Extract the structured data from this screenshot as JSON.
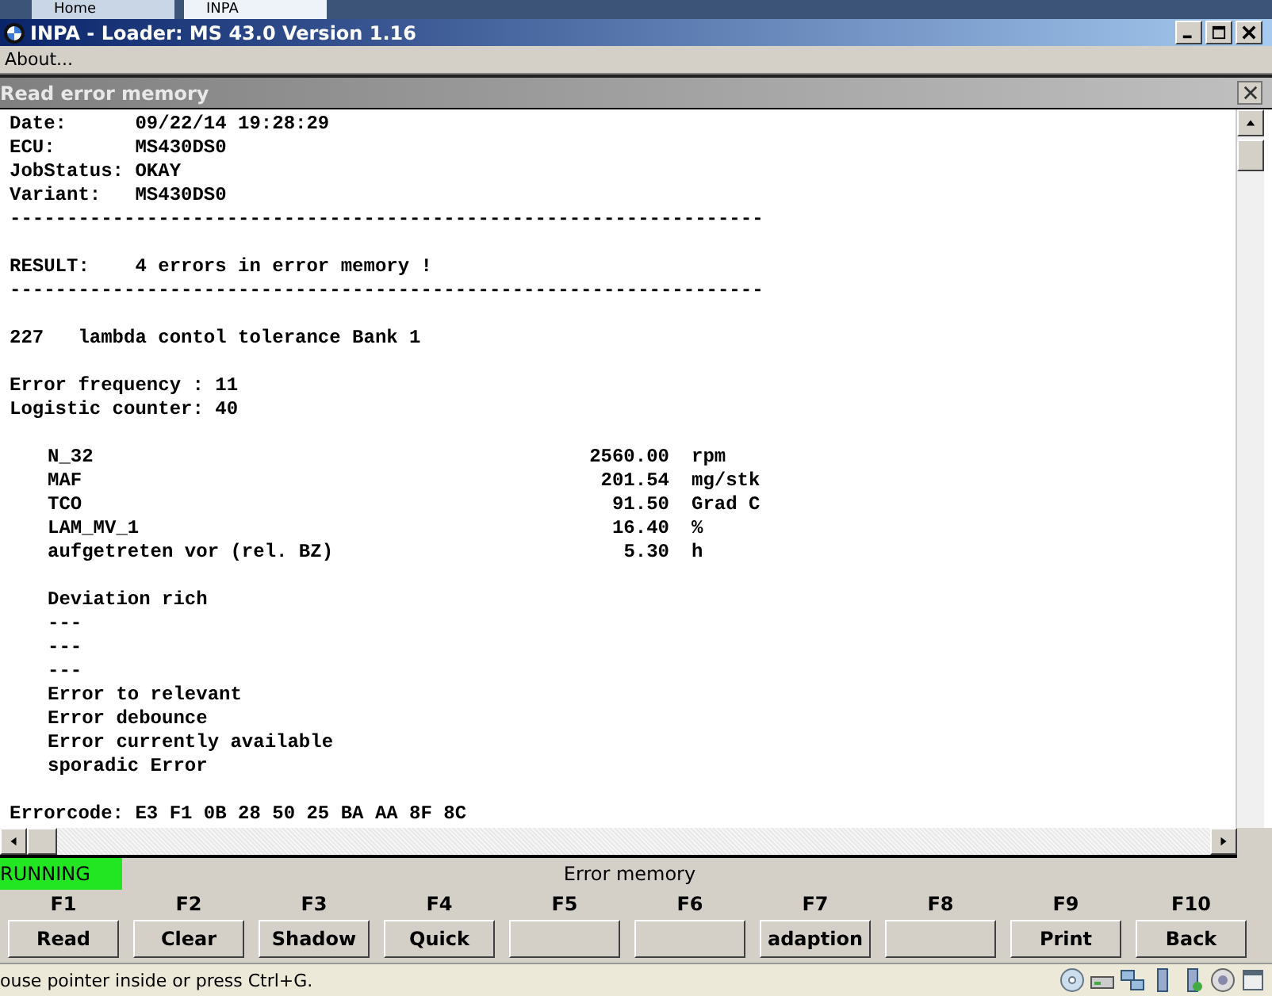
{
  "taskbar_tabs": [
    {
      "label": "Home",
      "selected": false
    },
    {
      "label": "INPA",
      "selected": true
    }
  ],
  "window": {
    "title": "INPA - Loader: MS 43.0 Version 1.16"
  },
  "menu": [
    "About..."
  ],
  "panel": {
    "title": "Read error memory"
  },
  "lines": [
    {
      "kind": "text",
      "text": "Date:      09/22/14 19:28:29"
    },
    {
      "kind": "text",
      "text": "ECU:       MS430DS0"
    },
    {
      "kind": "text",
      "text": "JobStatus: OKAY"
    },
    {
      "kind": "text",
      "text": "Variant:   MS430DS0"
    },
    {
      "kind": "rule",
      "text": "------------------------------------------------------------------"
    },
    {
      "kind": "blank"
    },
    {
      "kind": "text",
      "text": "RESULT:    4 errors in error memory !"
    },
    {
      "kind": "rule",
      "text": "------------------------------------------------------------------"
    },
    {
      "kind": "blank"
    },
    {
      "kind": "text",
      "text": "227   lambda contol tolerance Bank 1"
    },
    {
      "kind": "blank"
    },
    {
      "kind": "text",
      "text": "Error frequency : 11"
    },
    {
      "kind": "text",
      "text": "Logistic counter: 40"
    },
    {
      "kind": "blank"
    },
    {
      "kind": "measure",
      "name": "N_32",
      "value": "2560.00",
      "unit": "rpm"
    },
    {
      "kind": "measure",
      "name": "MAF",
      "value": "201.54",
      "unit": "mg/stk"
    },
    {
      "kind": "measure",
      "name": "TCO",
      "value": "91.50",
      "unit": "Grad C"
    },
    {
      "kind": "measure",
      "name": "LAM_MV_1",
      "value": "16.40",
      "unit": "%"
    },
    {
      "kind": "measure",
      "name": "aufgetreten vor (rel. BZ)",
      "value": "5.30",
      "unit": "h"
    },
    {
      "kind": "blank"
    },
    {
      "kind": "indent",
      "text": "Deviation rich"
    },
    {
      "kind": "indent",
      "text": "---"
    },
    {
      "kind": "indent",
      "text": "---"
    },
    {
      "kind": "indent",
      "text": "---"
    },
    {
      "kind": "indent",
      "text": "Error to relevant"
    },
    {
      "kind": "indent",
      "text": "Error debounce"
    },
    {
      "kind": "indent",
      "text": "Error currently available"
    },
    {
      "kind": "indent",
      "text": "sporadic Error"
    },
    {
      "kind": "blank"
    },
    {
      "kind": "text",
      "text": "Errorcode: E3 F1 0B 28 50 25 BA AA 8F 8C"
    }
  ],
  "status": {
    "state": "RUNNING",
    "title": "Error memory"
  },
  "function_keys": [
    {
      "key": "F1",
      "label": "Read"
    },
    {
      "key": "F2",
      "label": "Clear"
    },
    {
      "key": "F3",
      "label": "Shadow"
    },
    {
      "key": "F4",
      "label": "Quick"
    },
    {
      "key": "F5"
    },
    {
      "key": "F6"
    },
    {
      "key": "F7",
      "label": "adaption"
    },
    {
      "key": "F8"
    },
    {
      "key": "F9",
      "label": "Print"
    },
    {
      "key": "F10",
      "label": "Back"
    }
  ],
  "status_bar": {
    "text": "ouse pointer inside or press Ctrl+G."
  }
}
